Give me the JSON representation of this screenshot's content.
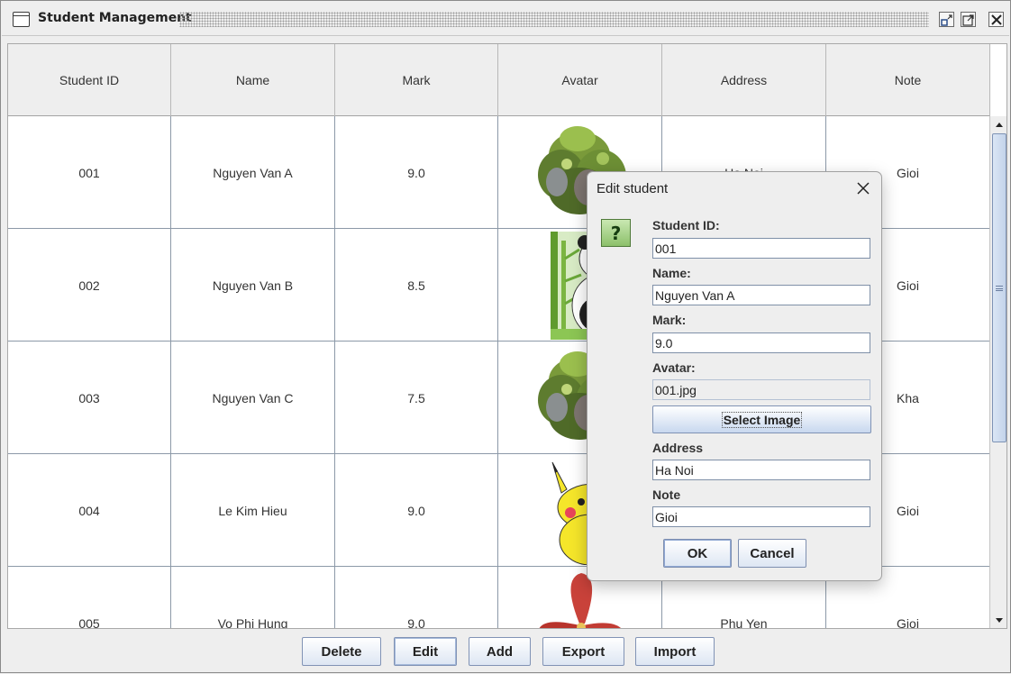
{
  "window": {
    "title": "Student Management",
    "icon": "window-icon"
  },
  "table": {
    "columns": [
      "Student ID",
      "Name",
      "Mark",
      "Avatar",
      "Address",
      "Note"
    ],
    "rows": [
      {
        "id": "001",
        "name": "Nguyen Van A",
        "mark": "9.0",
        "avatar": "shrub-image",
        "address": "Ha Noi",
        "note": "Gioi"
      },
      {
        "id": "002",
        "name": "Nguyen Van B",
        "mark": "8.5",
        "avatar": "panda-image",
        "address": "",
        "note": "Gioi"
      },
      {
        "id": "003",
        "name": "Nguyen Van C",
        "mark": "7.5",
        "avatar": "shrub-image",
        "address": "",
        "note": "Kha"
      },
      {
        "id": "004",
        "name": "Le Kim Hieu",
        "mark": "9.0",
        "avatar": "pikachu-image",
        "address": "",
        "note": "Gioi"
      },
      {
        "id": "005",
        "name": "Vo Phi Hung",
        "mark": "9.0",
        "avatar": "flower-image",
        "address": "Phu Yen",
        "note": "Gioi"
      }
    ]
  },
  "buttons": {
    "delete": "Delete",
    "edit": "Edit",
    "add": "Add",
    "export": "Export",
    "import": "Import"
  },
  "dialog": {
    "title": "Edit student",
    "icon": "question-icon",
    "icon_glyph": "?",
    "student_id_label": "Student ID:",
    "student_id_value": "001",
    "name_label": "Name:",
    "name_value": "Nguyen Van A",
    "mark_label": "Mark:",
    "mark_value": "9.0",
    "avatar_label": "Avatar:",
    "avatar_value": "001.jpg",
    "select_image_label": "Select Image",
    "address_label": "Address",
    "address_value": "Ha Noi",
    "note_label": "Note",
    "note_value": "Gioi",
    "ok_label": "OK",
    "cancel_label": "Cancel"
  },
  "colors": {
    "accent": "#7f92b4",
    "question_icon": "#8cc06a"
  }
}
